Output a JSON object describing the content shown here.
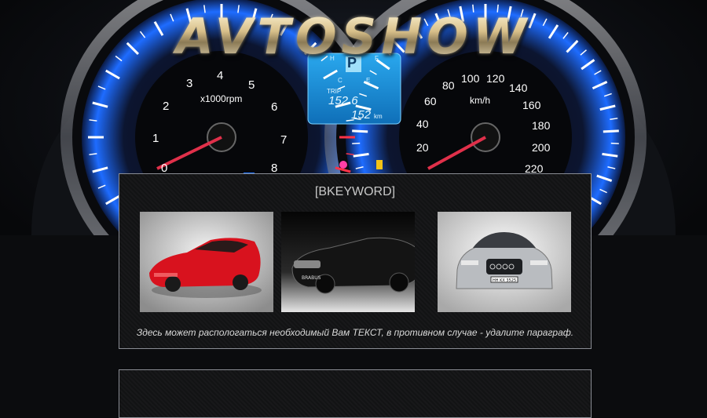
{
  "site": {
    "logo_text": "AVTOSHOW"
  },
  "dashboard": {
    "tachometer": {
      "unit": "x1000rpm",
      "ticks": [
        "0",
        "1",
        "2",
        "3",
        "4",
        "5",
        "6",
        "7",
        "8"
      ]
    },
    "speedometer": {
      "unit": "km/h",
      "ticks": [
        "20",
        "40",
        "60",
        "80",
        "100",
        "120",
        "140",
        "160",
        "180",
        "200",
        "220"
      ]
    },
    "display": {
      "gear": "P",
      "trip_label": "TRIP",
      "trip_value": "152.6",
      "odometer_value": "152",
      "odometer_unit": "km",
      "fuel_e": "E",
      "fuel_f": "F",
      "temp_c": "C",
      "temp_h": "H"
    },
    "colors": {
      "gauge_glow": "#1e6cff",
      "needle": "#e0304a",
      "lcd": "#1aa0e8"
    }
  },
  "main_panel": {
    "title": "[BKEYWORD]",
    "text": "Здесь может распологаться необходимый Вам ТЕКСТ, в противном случае - удалите параграф.",
    "photos": [
      {
        "label": "red sports car",
        "color": "#d8121e"
      },
      {
        "label": "black convertible",
        "plate": "BRABUS",
        "color": "#111111"
      },
      {
        "label": "silver coupe",
        "plate": "HH-KX 3525",
        "color": "#b9bcc0"
      }
    ]
  }
}
